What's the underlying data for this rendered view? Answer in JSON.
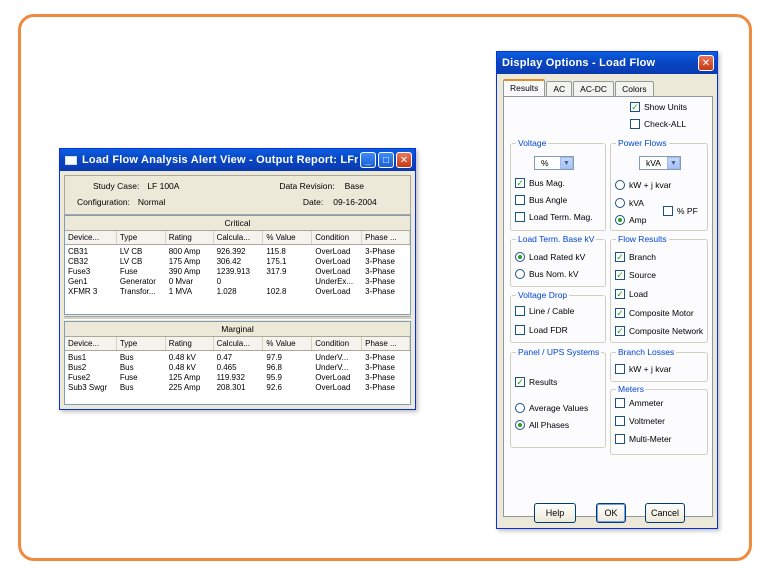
{
  "alert": {
    "title": "Load Flow Analysis Alert View - Output Report: LFreport",
    "study_case_label": "Study Case:",
    "study_case": "LF 100A",
    "data_revision_label": "Data Revision:",
    "data_revision": "Base",
    "configuration_label": "Configuration:",
    "configuration": "Normal",
    "date_label": "Date:",
    "date": "09-16-2004",
    "columns": [
      "Device...",
      "Type",
      "Rating",
      "Calcula...",
      "% Value",
      "Condition",
      "Phase ..."
    ],
    "critical": {
      "label": "Critical",
      "rows": [
        [
          "CB31",
          "LV CB",
          "800 Amp",
          "926.392",
          "115.8",
          "OverLoad",
          "3-Phase"
        ],
        [
          "CB32",
          "LV CB",
          "175 Amp",
          "306.42",
          "175.1",
          "OverLoad",
          "3-Phase"
        ],
        [
          "Fuse3",
          "Fuse",
          "390 Amp",
          "1239.913",
          "317.9",
          "OverLoad",
          "3-Phase"
        ],
        [
          "Gen1",
          "Generator",
          "0 Mvar",
          "0",
          "",
          "UnderEx...",
          "3-Phase"
        ],
        [
          "XFMR 3",
          "Transfor...",
          "1 MVA",
          "1.028",
          "102.8",
          "OverLoad",
          "3-Phase"
        ]
      ]
    },
    "marginal": {
      "label": "Marginal",
      "rows": [
        [
          "Bus1",
          "Bus",
          "0.48 kV",
          "0.47",
          "97.9",
          "UnderV...",
          "3-Phase"
        ],
        [
          "Bus2",
          "Bus",
          "0.48 kV",
          "0.465",
          "96.8",
          "UnderV...",
          "3-Phase"
        ],
        [
          "Fuse2",
          "Fuse",
          "125 Amp",
          "119.932",
          "95.9",
          "OverLoad",
          "3-Phase"
        ],
        [
          "Sub3 Swgr",
          "Bus",
          "225 Amp",
          "208.301",
          "92.6",
          "OverLoad",
          "3-Phase"
        ]
      ]
    }
  },
  "display": {
    "title": "Display Options - Load Flow",
    "tabs": [
      "Results",
      "AC",
      "AC-DC",
      "Colors"
    ],
    "show_units": "Show Units",
    "check_all": "Check-ALL",
    "voltage": {
      "title": "Voltage",
      "unit": "%",
      "bus_mag": "Bus Mag.",
      "bus_angle": "Bus Angle",
      "load_term_mag": "Load Term. Mag."
    },
    "power_flows": {
      "title": "Power Flows",
      "unit": "kVA",
      "kw_jkvar": "kW + j kvar",
      "kva": "kVA",
      "amp": "Amp",
      "pf": "% PF"
    },
    "load_term_base": {
      "title": "Load Term. Base kV",
      "load_rated": "Load Rated kV",
      "bus_nom": "Bus Nom. kV"
    },
    "flow_results": {
      "title": "Flow Results",
      "branch": "Branch",
      "source": "Source",
      "load": "Load",
      "composite_motor": "Composite Motor",
      "composite_network": "Composite Network"
    },
    "voltage_drop": {
      "title": "Voltage Drop",
      "line_cable": "Line / Cable",
      "load_fdr": "Load FDR"
    },
    "panel_ups": {
      "title": "Panel / UPS Systems",
      "results": "Results",
      "average": "Average Values",
      "all_phases": "All Phases"
    },
    "branch_losses": {
      "title": "Branch Losses",
      "kw_jkvar": "kW + j kvar"
    },
    "meters": {
      "title": "Meters",
      "ammeter": "Ammeter",
      "voltmeter": "Voltmeter",
      "multimeter": "Multi-Meter"
    },
    "buttons": {
      "help": "Help",
      "ok": "OK",
      "cancel": "Cancel"
    }
  }
}
